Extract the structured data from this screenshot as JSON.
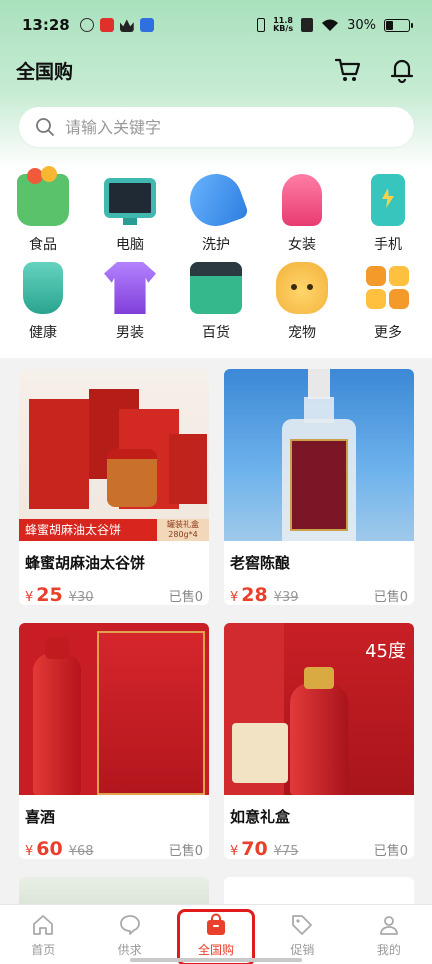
{
  "status_bar": {
    "time": "13:28",
    "network_speed": "11.8",
    "network_unit": "KB/s",
    "battery": "30%",
    "battery_level": 0.3
  },
  "header": {
    "title": "全国购",
    "cart_icon": "cart-icon",
    "bell_icon": "bell-icon"
  },
  "search": {
    "placeholder": "请输入关键字"
  },
  "categories": [
    {
      "label": "食品",
      "icon": "food-basket-icon",
      "color": "#5ac26a"
    },
    {
      "label": "电脑",
      "icon": "computer-icon",
      "color": "#3fb9b0"
    },
    {
      "label": "洗护",
      "icon": "hairdryer-icon",
      "color": "#3b8ee8"
    },
    {
      "label": "女装",
      "icon": "dress-icon",
      "color": "#f0568a"
    },
    {
      "label": "手机",
      "icon": "phone-icon",
      "color": "#37c5bd"
    },
    {
      "label": "健康",
      "icon": "health-jar-icon",
      "color": "#3fbfa8"
    },
    {
      "label": "男装",
      "icon": "tshirt-icon",
      "color": "#9a5ce0"
    },
    {
      "label": "百货",
      "icon": "store-box-icon",
      "color": "#35b98c"
    },
    {
      "label": "宠物",
      "icon": "pet-icon",
      "color": "#f2b03a"
    },
    {
      "label": "更多",
      "icon": "more-grid-icon",
      "color": "#f39a2a"
    }
  ],
  "products": [
    {
      "name": "蜂蜜胡麻油太谷饼",
      "currency": "¥",
      "price": "25",
      "original": "¥30",
      "sold": "已售0",
      "banner": "蜂蜜胡麻油太谷饼",
      "package": "罐装礼盒",
      "weight": "280g*4"
    },
    {
      "name": "老窖陈酿",
      "currency": "¥",
      "price": "28",
      "original": "¥39",
      "sold": "已售0"
    },
    {
      "name": "喜酒",
      "currency": "¥",
      "price": "60",
      "original": "¥68",
      "sold": "已售0"
    },
    {
      "name": "如意礼盒",
      "currency": "¥",
      "price": "70",
      "original": "¥75",
      "sold": "已售0",
      "badge": "45度"
    }
  ],
  "tabbar": [
    {
      "label": "首页",
      "icon": "home-icon"
    },
    {
      "label": "供求",
      "icon": "chat-bubble-icon"
    },
    {
      "label": "全国购",
      "icon": "shopping-bag-icon"
    },
    {
      "label": "促销",
      "icon": "tag-icon"
    },
    {
      "label": "我的",
      "icon": "user-icon"
    }
  ]
}
